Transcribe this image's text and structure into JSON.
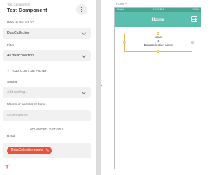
{
  "panel": {
    "subtitle": "Test Component",
    "title": "Test Component",
    "fields": {
      "list_of": {
        "label": "What is this list of?",
        "value": "DataCollection"
      },
      "filter": {
        "label": "Filter",
        "value": "All datacollection"
      },
      "add_filter": "ADD CUSTOM FILTER",
      "sorting": {
        "label": "Sorting",
        "placeholder": "Add sorting..."
      },
      "max_items": {
        "label": "Maximum number of items",
        "value": "No Maximum"
      }
    },
    "advanced": "ADVANCED OPTIONS",
    "detail": {
      "label": "Detail",
      "chip": "DataCollection name"
    }
  },
  "canvas": {
    "breadcrumb": "Home",
    "status": {
      "left": "Sketch",
      "time": "12:07 PM",
      "right": "100%"
    },
    "screen_title": "Home",
    "component": {
      "line1": "data",
      "line2": "1",
      "line3": "DataCollection name"
    }
  },
  "colors": {
    "accent": "#e9533b",
    "appbar": "#5bbfae",
    "statusbar": "#4aa595",
    "selection": "#e8b84b"
  },
  "icons": [
    "kebab-menu-icon",
    "chevron-down-icon",
    "plus-icon",
    "pencil-icon",
    "magic-text-icon",
    "home-icon",
    "exit-icon"
  ]
}
